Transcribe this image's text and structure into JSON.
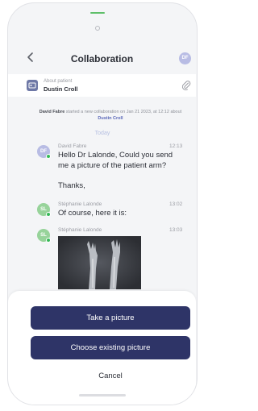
{
  "header": {
    "title": "Collaboration",
    "avatar_initials": "DF",
    "avatar_color": "#b8bce4",
    "back_icon": "chevron-left-icon"
  },
  "patient_bar": {
    "label": "About patient",
    "name": "Dustin Croll",
    "icon": "id-card-icon",
    "attach_icon": "paperclip-icon"
  },
  "system_message": {
    "actor": "David Fabre",
    "text": "started a new collaboration on Jan 21 2023, at 12:12 about",
    "patient_link": "Dustin Croll"
  },
  "date_separator": "Today",
  "messages": [
    {
      "sender": "David Fabre",
      "time": "12:13",
      "avatar_initials": "DF",
      "avatar_color": "#b8bce4",
      "lines": [
        "Hello Dr Lalonde, Could you send me a picture of the patient arm?",
        "",
        "Thanks,"
      ]
    },
    {
      "sender": "Stéphanie Lalonde",
      "time": "13:02",
      "avatar_initials": "SL",
      "avatar_color": "#97d39a",
      "text": "Of course, here it is:"
    },
    {
      "sender": "Stéphanie Lalonde",
      "time": "13:03",
      "avatar_initials": "SL",
      "avatar_color": "#97d39a",
      "attachment": "x-ray image"
    }
  ],
  "sheet": {
    "take_picture": "Take a picture",
    "choose_existing": "Choose existing picture",
    "cancel": "Cancel",
    "button_color": "#2e3467"
  },
  "colors": {
    "accent": "#5a67b8",
    "online": "#35b957"
  }
}
